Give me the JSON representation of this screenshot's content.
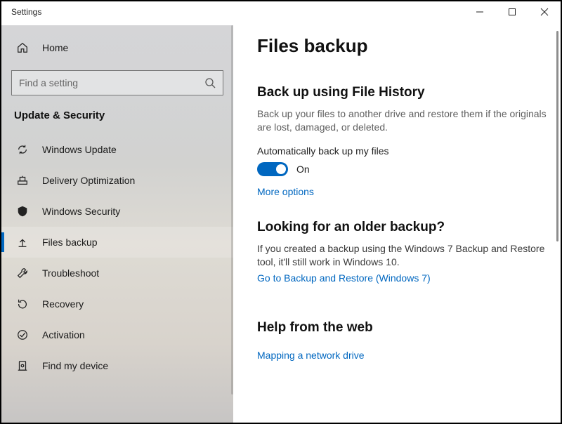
{
  "window": {
    "title": "Settings"
  },
  "sidebar": {
    "home": "Home",
    "search_placeholder": "Find a setting",
    "category": "Update & Security",
    "items": [
      {
        "label": "Windows Update"
      },
      {
        "label": "Delivery Optimization"
      },
      {
        "label": "Windows Security"
      },
      {
        "label": "Files backup"
      },
      {
        "label": "Troubleshoot"
      },
      {
        "label": "Recovery"
      },
      {
        "label": "Activation"
      },
      {
        "label": "Find my device"
      }
    ]
  },
  "main": {
    "title": "Files backup",
    "section1": {
      "heading": "Back up using File History",
      "desc": "Back up your files to another drive and restore them if the originals are lost, damaged, or deleted.",
      "toggle_label": "Automatically back up my files",
      "toggle_state": "On",
      "more": "More options"
    },
    "section2": {
      "heading": "Looking for an older backup?",
      "desc": "If you created a backup using the Windows 7 Backup and Restore tool, it'll still work in Windows 10.",
      "link": "Go to Backup and Restore (Windows 7)"
    },
    "section3": {
      "heading": "Help from the web",
      "link": "Mapping a network drive"
    }
  }
}
